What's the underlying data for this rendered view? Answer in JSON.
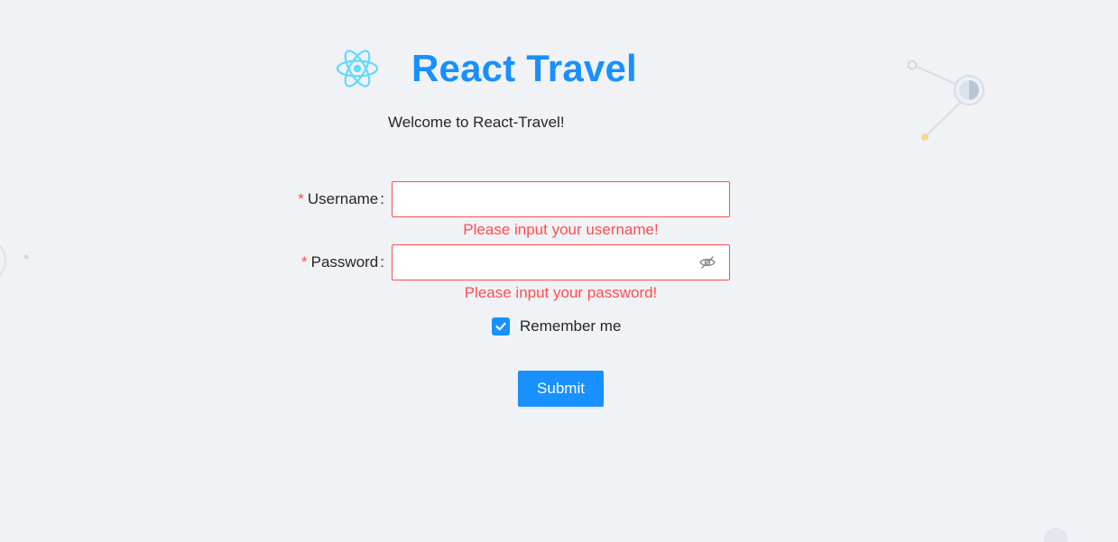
{
  "header": {
    "logo_icon": "react-atom-icon",
    "title": "React Travel",
    "welcome": "Welcome to React-Travel!"
  },
  "form": {
    "required_mark": "*",
    "colon": ":",
    "username": {
      "label": "Username",
      "value": "",
      "error": "Please input your username!"
    },
    "password": {
      "label": "Password",
      "value": "",
      "toggle_icon": "eye-invisible-icon",
      "error": "Please input your password!"
    },
    "remember": {
      "label": "Remember me",
      "checked": true
    },
    "submit_label": "Submit"
  },
  "colors": {
    "primary": "#1890ff",
    "error": "#ff4d4f",
    "background": "#f0f2f5",
    "logo": "#61dafb"
  }
}
